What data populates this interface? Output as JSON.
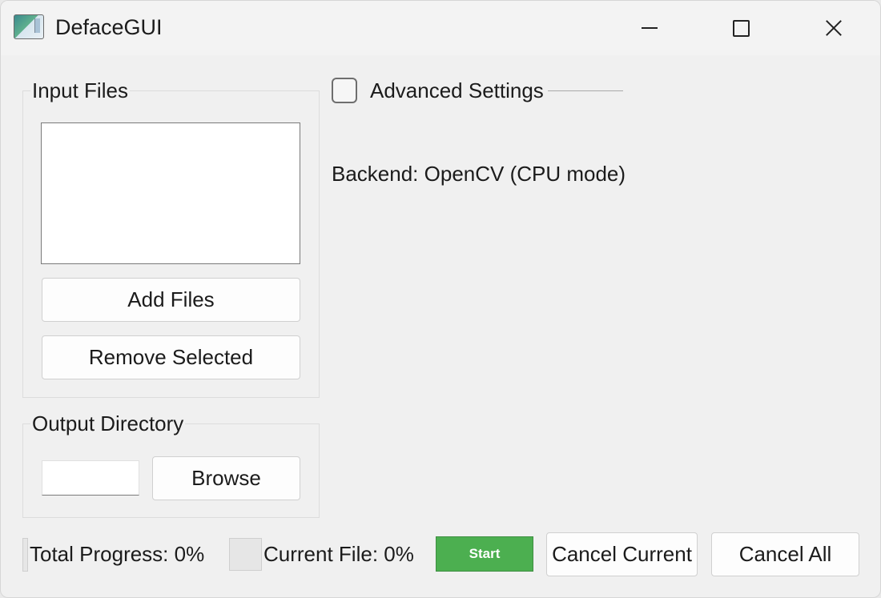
{
  "window": {
    "title": "DefaceGUI"
  },
  "input_files": {
    "group_title": "Input Files",
    "add_label": "Add Files",
    "remove_label": "Remove Selected",
    "items": []
  },
  "output_directory": {
    "group_title": "Output Directory",
    "value": "",
    "browse_label": "Browse"
  },
  "advanced": {
    "label": "Advanced Settings",
    "checked": false
  },
  "backend_text": "Backend: OpenCV (CPU mode)",
  "status": {
    "total_progress_text": "Total Progress: 0%",
    "total_progress_value": 0,
    "current_file_text": "Current File: 0%",
    "current_file_value": 0
  },
  "actions": {
    "start_label": "Start",
    "cancel_current_label": "Cancel Current",
    "cancel_all_label": "Cancel All"
  },
  "colors": {
    "start_button": "#4caf50",
    "window_bg": "#f0f0f0"
  }
}
